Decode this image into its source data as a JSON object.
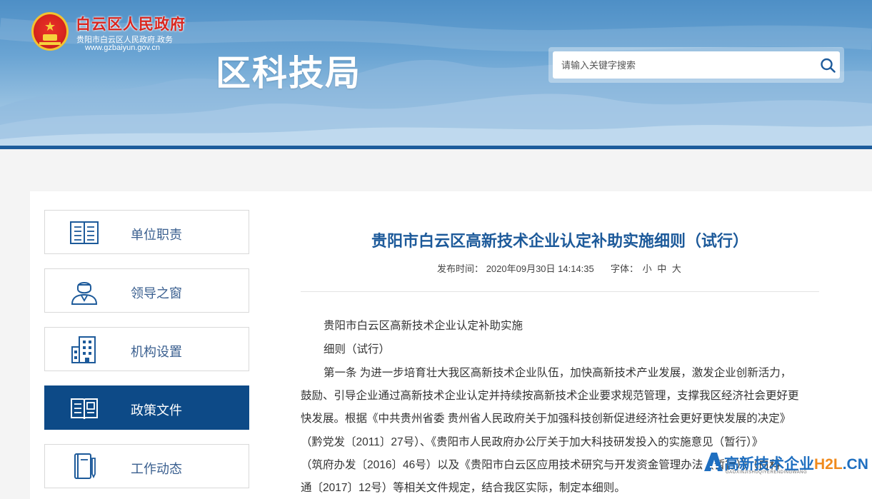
{
  "header": {
    "gov_name": "白云区人民政府",
    "gov_domain_cn": "贵阳市白云区人民政府.政务",
    "gov_url": "www.gzbaiyun.gov.cn",
    "dept_title": "区科技局",
    "search_placeholder": "请输入关键字搜索",
    "colors": {
      "banner": "#5b9bd0",
      "banner_line": "#1c5c9c",
      "gov_name": "#d9261f"
    }
  },
  "sidebar": {
    "items": [
      {
        "label": "单位职责",
        "icon": "responsibility-book-icon",
        "active": false
      },
      {
        "label": "领导之窗",
        "icon": "leader-person-icon",
        "active": false
      },
      {
        "label": "机构设置",
        "icon": "building-icon",
        "active": false
      },
      {
        "label": "政策文件",
        "icon": "open-book-icon",
        "active": true
      },
      {
        "label": "工作动态",
        "icon": "notebook-pen-icon",
        "active": false
      }
    ],
    "colors": {
      "active_bg": "#0d4a87",
      "label": "#3a5f8f"
    }
  },
  "article": {
    "title": "贵阳市白云区高新技术企业认定补助实施细则（试行）",
    "publish_label": "发布时间：",
    "publish_time": "2020年09月30日 14:14:35",
    "font_label": "字体：",
    "font_small": "小",
    "font_medium": "中",
    "font_large": "大",
    "lines": [
      "贵阳市白云区高新技术企业认定补助实施",
      "细则（试行）"
    ],
    "body_lines": [
      "第一条  为进一步培育壮大我区高新技术企业队伍，加快高新技术产业发展，激发企业创新活力，",
      "鼓励、引导企业通过高新技术企业认定并持续按高新技术企业要求规范管理，支撑我区经济社会更好更",
      "快发展。根据《中共贵州省委  贵州省人民政府关于加强科技创新促进经济社会更好更快发展的决定》",
      "（黔党发〔2011〕27号）、《贵阳市人民政府办公厅关于加大科技研发投入的实施意见（暂行）》",
      "（筑府办发〔2016〕46号）以及《贵阳市白云区应用技术研究与开发资金管理办法（暂行）》（白科",
      "通〔2017〕12号）等相关文件规定，结合我区实际，制定本细则。"
    ],
    "colors": {
      "title": "#1d5a9a"
    }
  },
  "watermark": {
    "text_main": "高新技术企业",
    "text_site": "H2L",
    "text_cn": ".CN",
    "sub": "GAOXINJISHUQIYERENDINGWANG"
  }
}
